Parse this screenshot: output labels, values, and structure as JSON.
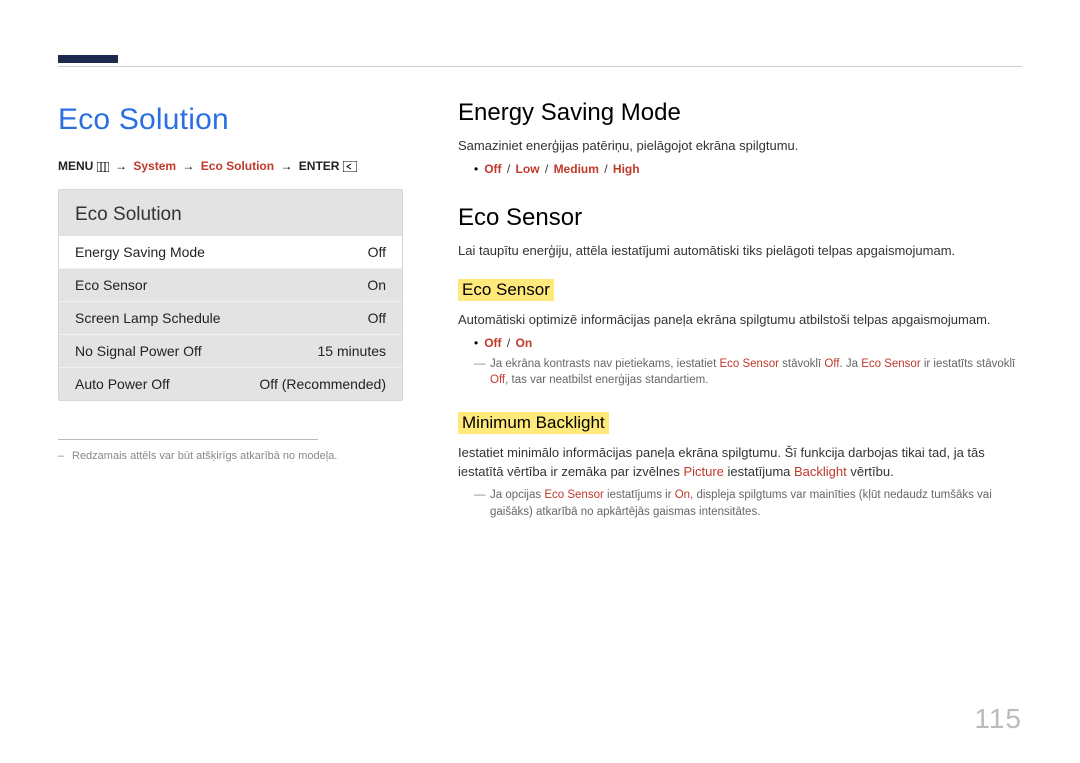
{
  "pageNumber": "115",
  "left": {
    "title": "Eco Solution",
    "crumb": {
      "menu": "MENU",
      "system": "System",
      "eco": "Eco Solution",
      "enter": "ENTER"
    },
    "panel": {
      "title": "Eco Solution",
      "rows": [
        {
          "label": "Energy Saving Mode",
          "value": "Off",
          "selected": true
        },
        {
          "label": "Eco Sensor",
          "value": "On",
          "selected": false
        },
        {
          "label": "Screen Lamp Schedule",
          "value": "Off",
          "selected": false
        },
        {
          "label": "No Signal Power Off",
          "value": "15 minutes",
          "selected": false
        },
        {
          "label": "Auto Power Off",
          "value": "Off (Recommended)",
          "selected": false
        }
      ]
    },
    "note": "Redzamais attēls var būt atšķirīgs atkarībā no modeļa."
  },
  "right": {
    "energy": {
      "heading": "Energy Saving Mode",
      "desc": "Samaziniet enerģijas patēriņu, pielāgojot ekrāna spilgtumu.",
      "options": [
        "Off",
        "Low",
        "Medium",
        "High"
      ]
    },
    "ecoSensor": {
      "heading": "Eco Sensor",
      "desc": "Lai taupītu enerģiju, attēla iestatījumi automātiski tiks pielāgoti telpas apgaismojumam.",
      "sub1": {
        "heading": "Eco Sensor",
        "desc": "Automātiski optimizē informācijas paneļa ekrāna spilgtumu atbilstoši telpas apgaismojumam.",
        "options": [
          "Off",
          "On"
        ],
        "note_pre": "Ja ekrāna kontrasts nav pietiekams, iestatiet ",
        "note_t1": "Eco Sensor",
        "note_mid1": " stāvoklī ",
        "note_t2": "Off",
        "note_mid2": ". Ja ",
        "note_t3": "Eco Sensor",
        "note_mid3": " ir iestatīts stāvoklī ",
        "note_t4": "Off",
        "note_post": ", tas var neatbilst enerģijas standartiem."
      },
      "sub2": {
        "heading": "Minimum Backlight",
        "desc_pre": "Iestatiet minimālo informācijas paneļa ekrāna spilgtumu. Šī funkcija darbojas tikai tad, ja tās iestatītā vērtība ir zemāka par izvēlnes ",
        "desc_t1": "Picture",
        "desc_mid": " iestatījuma ",
        "desc_t2": "Backlight",
        "desc_post": " vērtību.",
        "note_pre": "Ja opcijas ",
        "note_t1": "Eco Sensor",
        "note_mid1": " iestatījums ir ",
        "note_t2": "On",
        "note_post": ", displeja spilgtums var mainīties (kļūt nedaudz tumšāks vai gaišāks) atkarībā no apkārtējās gaismas intensitātes."
      }
    }
  }
}
